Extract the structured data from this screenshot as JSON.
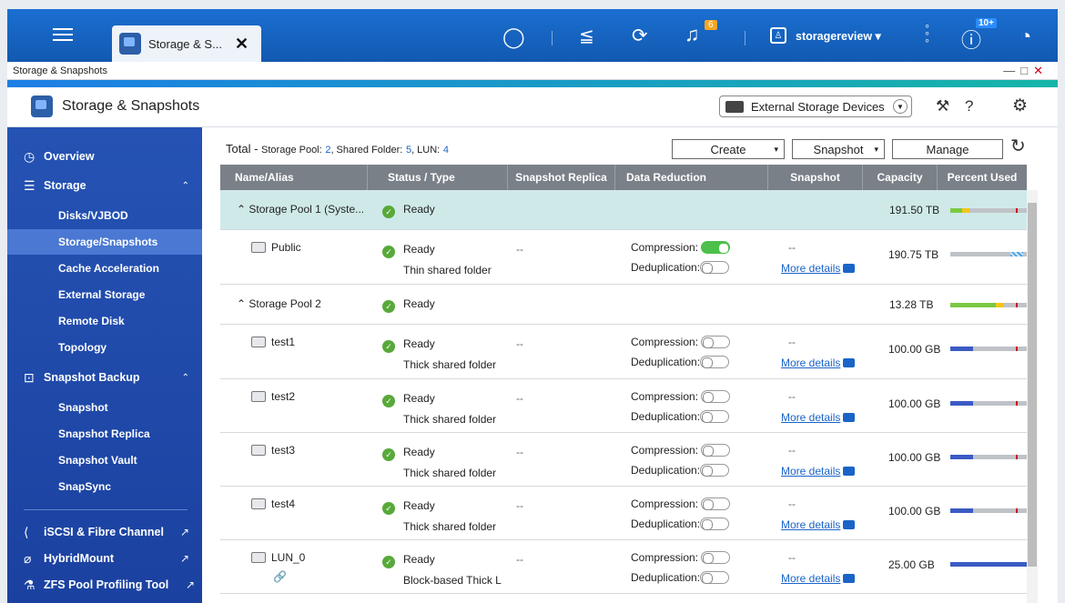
{
  "taskbar": {
    "app_tab_title": "Storage & S...",
    "notification_count": "6",
    "user": "storagereview",
    "update_badge": "10+"
  },
  "window": {
    "title": "Storage & Snapshots"
  },
  "header": {
    "title": "Storage & Snapshots",
    "external_label": "External Storage Devices"
  },
  "sidebar": {
    "overview": "Overview",
    "storage": "Storage",
    "storage_items": [
      "Disks/VJBOD",
      "Storage/Snapshots",
      "Cache Acceleration",
      "External Storage",
      "Remote Disk",
      "Topology"
    ],
    "snapshot_backup": "Snapshot Backup",
    "backup_items": [
      "Snapshot",
      "Snapshot Replica",
      "Snapshot Vault",
      "SnapSync"
    ],
    "iscsi": "iSCSI & Fibre Channel",
    "hybridmount": "HybridMount",
    "zfs": "ZFS Pool Profiling Tool"
  },
  "summary": {
    "total": "Total -",
    "pool_label": "Storage Pool:",
    "pool_count": "2",
    "folder_label": ", Shared Folder:",
    "folder_count": "5",
    "lun_label": ", LUN:",
    "lun_count": "4"
  },
  "actions": {
    "create": "Create",
    "snapshot": "Snapshot",
    "manage": "Manage"
  },
  "columns": [
    "Name/Alias",
    "Status / Type",
    "Snapshot Replica",
    "Data Reduction",
    "Snapshot",
    "Capacity",
    "Percent Used"
  ],
  "labels": {
    "compression": "Compression:",
    "dedup": "Deduplication:",
    "more": "More details",
    "dash": "--"
  },
  "pools": [
    {
      "name": "Storage Pool 1 (Syste...",
      "status": "Ready",
      "capacity": "191.50 TB"
    },
    {
      "name": "Storage Pool 2",
      "status": "Ready",
      "capacity": "13.28 TB"
    }
  ],
  "folders": [
    {
      "name": "Public",
      "status": "Ready",
      "type": "Thin shared folder",
      "capacity": "190.75 TB",
      "compression": true,
      "used": 0.88
    },
    {
      "name": "test1",
      "status": "Ready",
      "type": "Thick shared folder",
      "capacity": "100.00 GB",
      "compression": false,
      "used": 0.3
    },
    {
      "name": "test2",
      "status": "Ready",
      "type": "Thick shared folder",
      "capacity": "100.00 GB",
      "compression": false,
      "used": 0.3
    },
    {
      "name": "test3",
      "status": "Ready",
      "type": "Thick shared folder",
      "capacity": "100.00 GB",
      "compression": false,
      "used": 0.3
    },
    {
      "name": "test4",
      "status": "Ready",
      "type": "Thick shared folder",
      "capacity": "100.00 GB",
      "compression": false,
      "used": 0.3
    },
    {
      "name": "LUN_0",
      "status": "Ready",
      "type": "Block-based Thick L",
      "capacity": "25.00 GB",
      "compression": false,
      "used": 1.0
    }
  ],
  "pool_usage": [
    0.2,
    0.75
  ],
  "colors": {
    "accent": "#1565c0",
    "ready": "#58a93a",
    "link": "#1a64c8",
    "selected_row": "#cfe9e9"
  }
}
